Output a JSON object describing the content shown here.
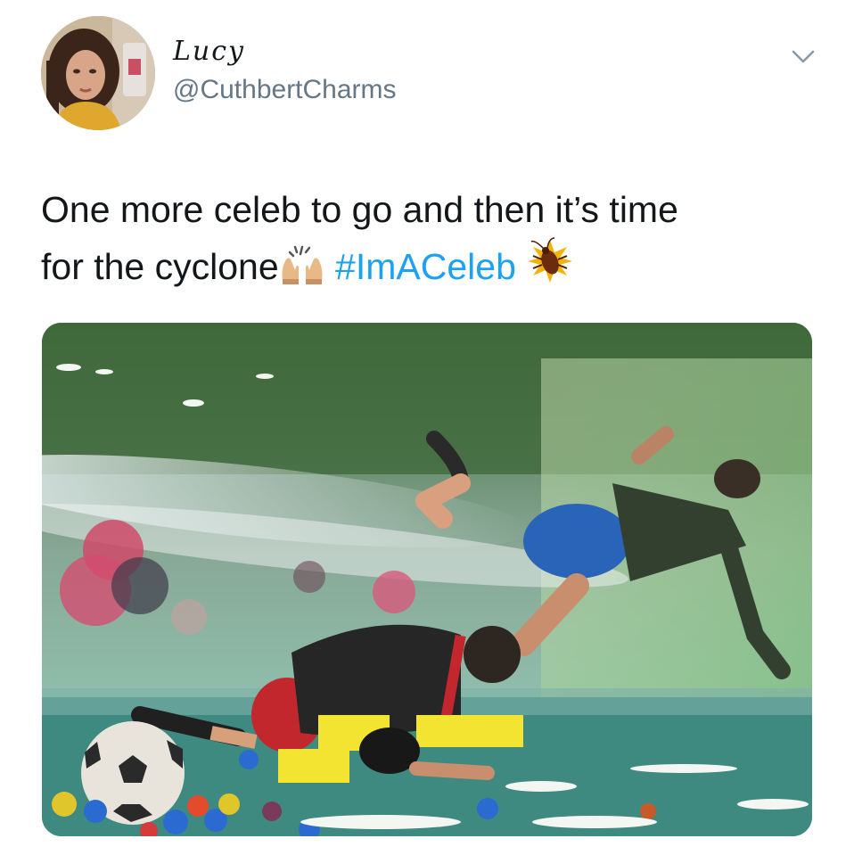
{
  "tweet": {
    "display_name": "Lucy",
    "handle": "@CuthbertCharms",
    "text_line1": "One more celeb to go and then it’s time",
    "text_line2_start": "for the cyclone",
    "hashtag": "#ImACeleb",
    "emoji_1": "raising-hands-icon",
    "emoji_2": "cockroach-icon",
    "menu_icon": "chevron-down-icon"
  },
  "colors": {
    "text": "#14171a",
    "secondary": "#657786",
    "link": "#1da1f2"
  }
}
